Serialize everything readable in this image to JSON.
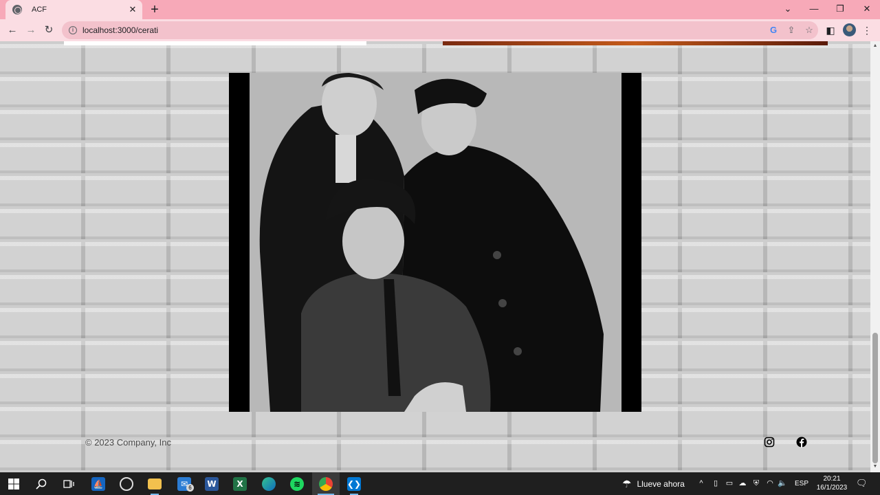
{
  "browser": {
    "tab_title": "ACF",
    "url": "localhost:3000/cerati"
  },
  "page": {
    "photo_alt": "Soda Stereo band photo",
    "footer_copyright": "© 2023 Company, Inc",
    "social": [
      "instagram-icon",
      "facebook-icon"
    ]
  },
  "taskbar": {
    "apps": [
      "start",
      "search",
      "task-view",
      "app-blue",
      "app-drive",
      "file-explorer",
      "mail",
      "word",
      "excel",
      "edge",
      "spotify",
      "chrome",
      "vscode"
    ],
    "mail_badge": "6",
    "weather": "Llueve ahora",
    "language": "ESP",
    "time": "20:21",
    "date": "16/1/2023"
  }
}
